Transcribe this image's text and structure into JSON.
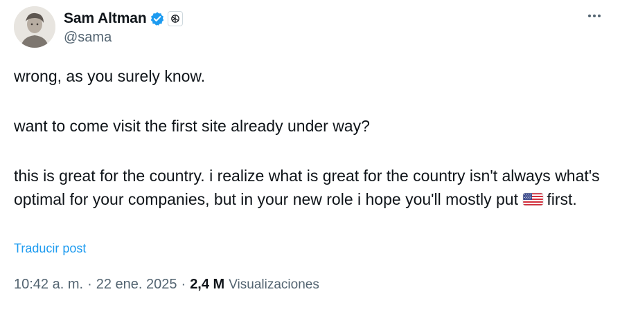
{
  "author": {
    "display_name": "Sam Altman",
    "handle": "@sama"
  },
  "post": {
    "paragraphs": [
      "wrong, as you surely know.",
      "want to come visit the first site already under way?",
      "this is great for the country. i realize what is great for the country isn't always what's optimal for your companies, but in your new role i hope you'll mostly put"
    ],
    "after_flag_text": "first.",
    "flag_emoji": "us-flag-icon"
  },
  "translate_label": "Traducir post",
  "meta": {
    "time": "10:42 a. m.",
    "separator": "·",
    "date": "22 ene. 2025",
    "views_count": "2,4 M",
    "views_label": "Visualizaciones"
  },
  "colors": {
    "text_primary": "#0f1419",
    "text_secondary": "#536471",
    "accent_blue": "#1d9bf0"
  }
}
